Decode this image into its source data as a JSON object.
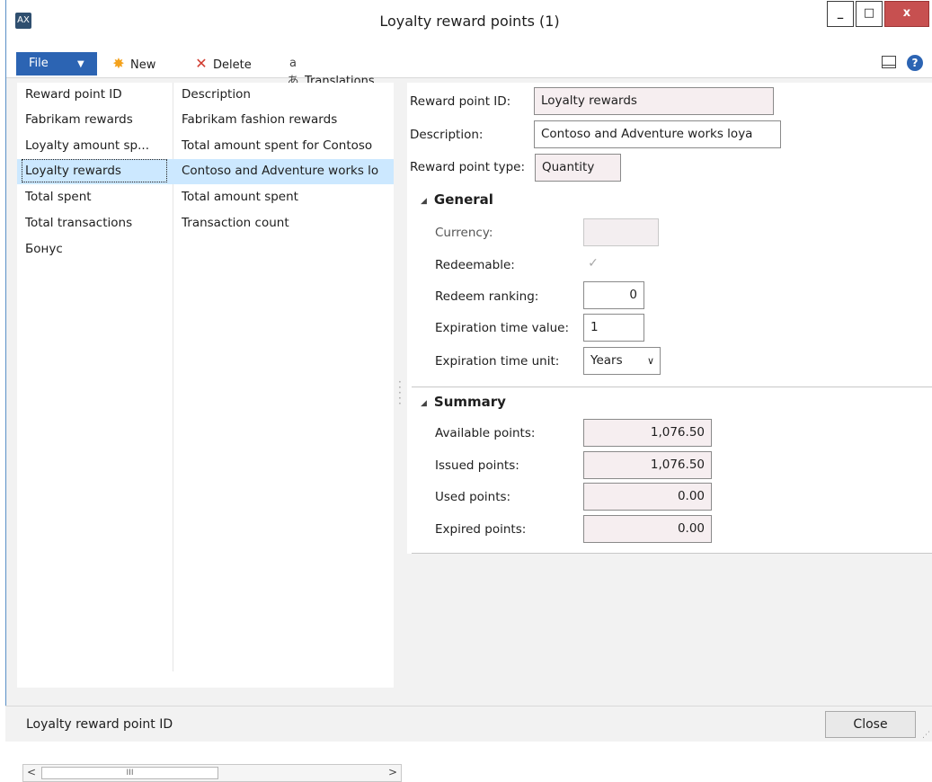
{
  "window": {
    "title": "Loyalty reward points (1)",
    "app_icon": "dynamics-ax-icon"
  },
  "toolbar": {
    "file_label": "File",
    "new_label": "New",
    "delete_label": "Delete",
    "translations_label": "Translations"
  },
  "list": {
    "columns": [
      "Reward point ID",
      "Description"
    ],
    "rows": [
      {
        "id": "Fabrikam rewards",
        "description": "Fabrikam fashion rewards"
      },
      {
        "id": "Loyalty amount sp...",
        "description": "Total amount spent for Contoso"
      },
      {
        "id": "Loyalty rewards",
        "description": "Contoso and Adventure works lo"
      },
      {
        "id": "Total spent",
        "description": "Total amount spent"
      },
      {
        "id": "Total transactions",
        "description": "Transaction count"
      },
      {
        "id": "Бонус",
        "description": ""
      }
    ],
    "selected_index": 2
  },
  "detail": {
    "reward_point_id_label": "Reward point ID:",
    "reward_point_id": "Loyalty rewards",
    "description_label": "Description:",
    "description": "Contoso and Adventure works loya",
    "reward_point_type_label": "Reward point type:",
    "reward_point_type": "Quantity",
    "general": {
      "heading": "General",
      "currency_label": "Currency:",
      "currency": "",
      "redeemable_label": "Redeemable:",
      "redeemable": true,
      "redeem_ranking_label": "Redeem ranking:",
      "redeem_ranking": "0",
      "expiration_value_label": "Expiration time value:",
      "expiration_value": "1",
      "expiration_unit_label": "Expiration time unit:",
      "expiration_unit": "Years"
    },
    "summary": {
      "heading": "Summary",
      "available_label": "Available points:",
      "available": "1,076.50",
      "issued_label": "Issued points:",
      "issued": "1,076.50",
      "used_label": "Used points:",
      "used": "0.00",
      "expired_label": "Expired points:",
      "expired": "0.00"
    }
  },
  "status": {
    "text": "Loyalty reward point ID",
    "close_label": "Close"
  },
  "colors": {
    "accent": "#2c64b3",
    "selection": "#cce8ff",
    "close_button": "#c75050"
  }
}
